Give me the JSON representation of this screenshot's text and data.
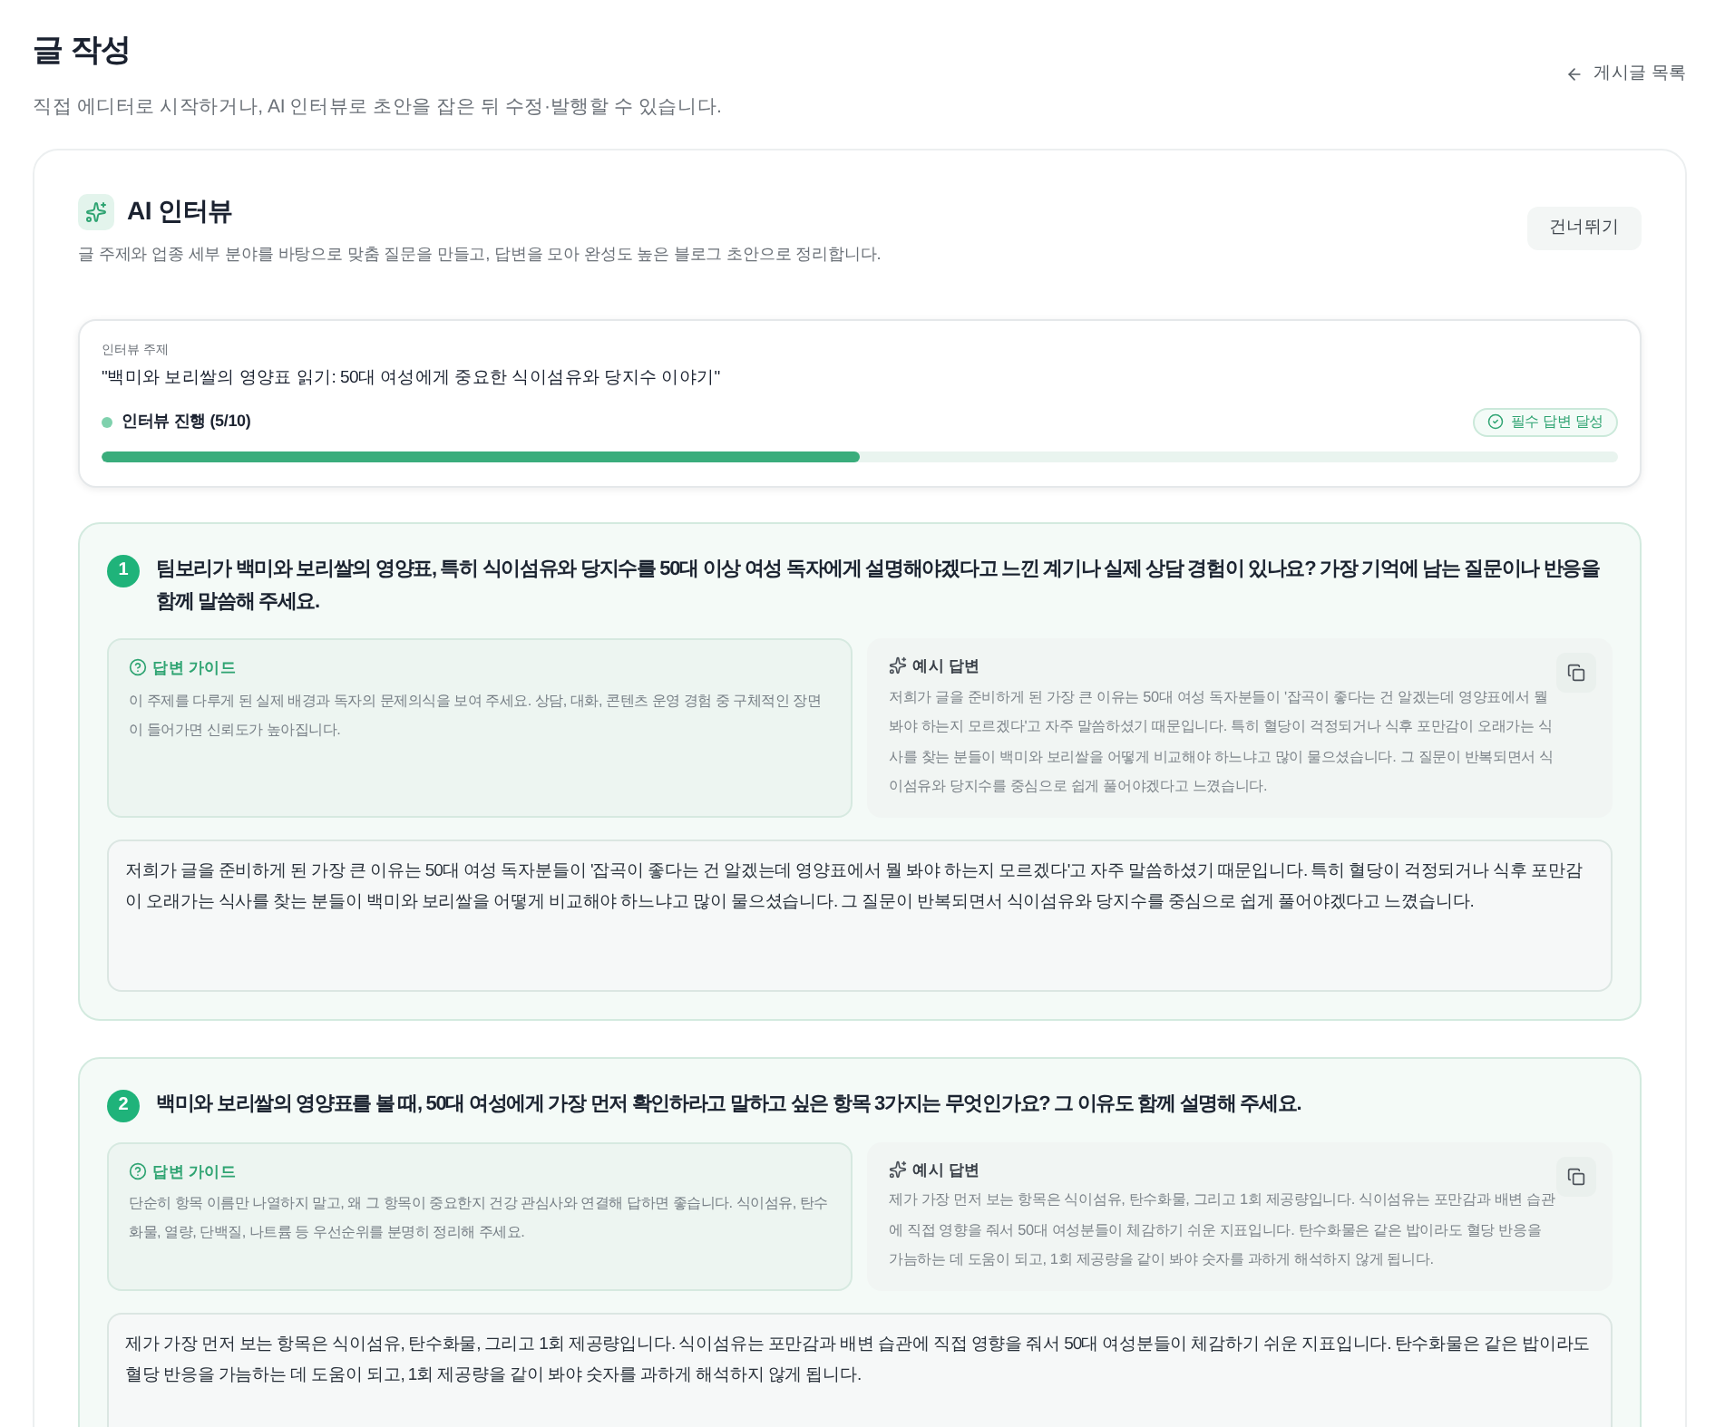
{
  "page": {
    "title": "글 작성",
    "subtitle": "직접 에디터로 시작하거나, AI 인터뷰로 초안을 잡은 뒤 수정·발행할 수 있습니다.",
    "back_link": "게시글 목록"
  },
  "interview": {
    "title": "AI 인터뷰",
    "description": "글 주제와 업종 세부 분야를 바탕으로 맞춤 질문을 만들고, 답변을 모아 완성도 높은 블로그 초안으로 정리합니다.",
    "skip_button": "건너뛰기"
  },
  "topic": {
    "label": "인터뷰 주제",
    "value": "\"백미와 보리쌀의 영양표 읽기: 50대 여성에게 중요한 식이섬유와 당지수 이야기\""
  },
  "progress": {
    "label": "인터뷰 진행 (5/10)",
    "level": 0.5,
    "badge": "필수 답변 달성"
  },
  "questions": [
    {
      "number": "1",
      "text": "팀보리가 백미와 보리쌀의 영양표, 특히 식이섬유와 당지수를 50대 이상 여성 독자에게 설명해야겠다고 느낀 계기나 실제 상담 경험이 있나요? 가장 기억에 남는 질문이나 반응을 함께 말씀해 주세요.",
      "guide": {
        "title": "답변 가이드",
        "text": "이 주제를 다루게 된 실제 배경과 독자의 문제의식을 보여 주세요. 상담, 대화, 콘텐츠 운영 경험 중 구체적인 장면이 들어가면 신뢰도가 높아집니다."
      },
      "example": {
        "title": "예시 답변",
        "text": "저희가 글을 준비하게 된 가장 큰 이유는 50대 여성 독자분들이 '잡곡이 좋다는 건 알겠는데 영양표에서 뭘 봐야 하는지 모르겠다'고 자주 말씀하셨기 때문입니다. 특히 혈당이 걱정되거나 식후 포만감이 오래가는 식사를 찾는 분들이 백미와 보리쌀을 어떻게 비교해야 하느냐고 많이 물으셨습니다. 그 질문이 반복되면서 식이섬유와 당지수를 중심으로 쉽게 풀어야겠다고 느꼈습니다."
      },
      "answer": "저희가 글을 준비하게 된 가장 큰 이유는 50대 여성 독자분들이 '잡곡이 좋다는 건 알겠는데 영양표에서 뭘 봐야 하는지 모르겠다'고 자주 말씀하셨기 때문입니다. 특히 혈당이 걱정되거나 식후 포만감이 오래가는 식사를 찾는 분들이 백미와 보리쌀을 어떻게 비교해야 하느냐고 많이 물으셨습니다. 그 질문이 반복되면서 식이섬유와 당지수를 중심으로 쉽게 풀어야겠다고 느꼈습니다."
    },
    {
      "number": "2",
      "text": "백미와 보리쌀의 영양표를 볼 때, 50대 여성에게 가장 먼저 확인하라고 말하고 싶은 항목 3가지는 무엇인가요? 그 이유도 함께 설명해 주세요.",
      "guide": {
        "title": "답변 가이드",
        "text": "단순히 항목 이름만 나열하지 말고, 왜 그 항목이 중요한지 건강 관심사와 연결해 답하면 좋습니다. 식이섬유, 탄수화물, 열량, 단백질, 나트륨 등 우선순위를 분명히 정리해 주세요."
      },
      "example": {
        "title": "예시 답변",
        "text": "제가 가장 먼저 보는 항목은 식이섬유, 탄수화물, 그리고 1회 제공량입니다. 식이섬유는 포만감과 배변 습관에 직접 영향을 줘서 50대 여성분들이 체감하기 쉬운 지표입니다. 탄수화물은 같은 밥이라도 혈당 반응을 가늠하는 데 도움이 되고, 1회 제공량을 같이 봐야 숫자를 과하게 해석하지 않게 됩니다."
      },
      "answer": "제가 가장 먼저 보는 항목은 식이섬유, 탄수화물, 그리고 1회 제공량입니다. 식이섬유는 포만감과 배변 습관에 직접 영향을 줘서 50대 여성분들이 체감하기 쉬운 지표입니다. 탄수화물은 같은 밥이라도 혈당 반응을 가늠하는 데 도움이 되고, 1회 제공량을 같이 봐야 숫자를 과하게 해석하지 않게 됩니다."
    }
  ]
}
